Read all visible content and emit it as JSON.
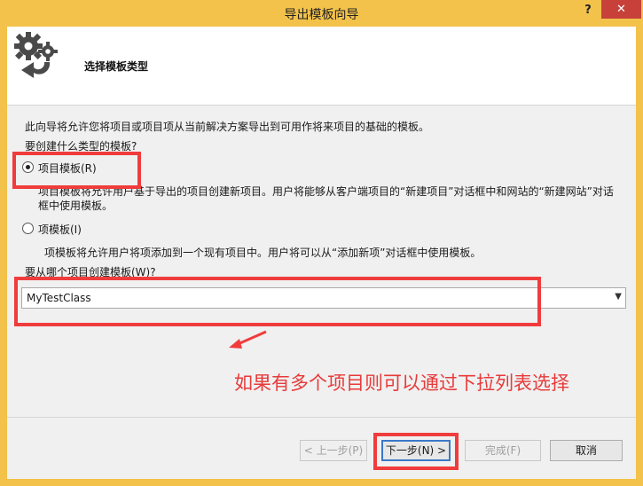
{
  "window": {
    "title": "导出模板向导",
    "help_label": "?",
    "close_label": "✕"
  },
  "header": {
    "title": "选择模板类型",
    "icon": "gears-export-icon"
  },
  "content": {
    "intro": "此向导将允许您将项目或项目项从当前解决方案导出到可用作将来项目的基础的模板。",
    "question": "要创建什么类型的模板?",
    "options": [
      {
        "label": "项目模板(R)",
        "selected": true,
        "description": "项目模板将允许用户基于导出的项目创建新项目。用户将能够从客户端项目的“新建项目”对话框中和网站的“新建网站”对话框中使用模板。"
      },
      {
        "label": "项模板(I)",
        "selected": false,
        "description": "项模板将允许用户将项添加到一个现有项目中。用户将可以从“添加新项”对话框中使用模板。"
      }
    ],
    "combo_label": "要从哪个项目创建模板(W)?",
    "combo_value": "MyTestClass"
  },
  "annotation": {
    "text": "如果有多个项目则可以通过下拉列表选择",
    "color": "#f03c3c"
  },
  "buttons": {
    "prev": "< 上一步(P)",
    "next": "下一步(N) >",
    "finish": "完成(F)",
    "cancel": "取消"
  },
  "colors": {
    "titlebar": "#f3c24a",
    "close": "#c7413a",
    "focus": "#3a78c8"
  }
}
